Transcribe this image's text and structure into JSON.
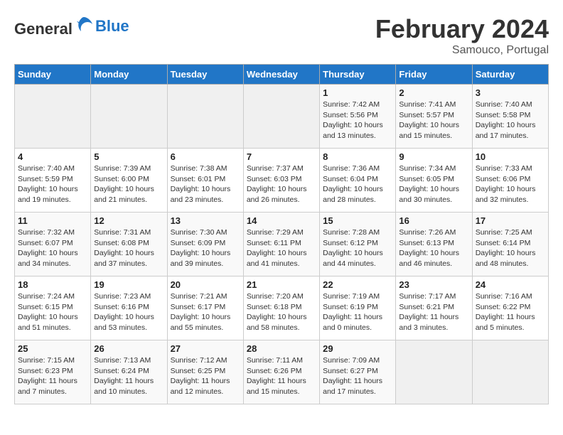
{
  "header": {
    "logo_line1": "General",
    "logo_line2": "Blue",
    "month": "February 2024",
    "location": "Samouco, Portugal"
  },
  "weekdays": [
    "Sunday",
    "Monday",
    "Tuesday",
    "Wednesday",
    "Thursday",
    "Friday",
    "Saturday"
  ],
  "weeks": [
    [
      {
        "day": "",
        "info": ""
      },
      {
        "day": "",
        "info": ""
      },
      {
        "day": "",
        "info": ""
      },
      {
        "day": "",
        "info": ""
      },
      {
        "day": "1",
        "info": "Sunrise: 7:42 AM\nSunset: 5:56 PM\nDaylight: 10 hours and 13 minutes."
      },
      {
        "day": "2",
        "info": "Sunrise: 7:41 AM\nSunset: 5:57 PM\nDaylight: 10 hours and 15 minutes."
      },
      {
        "day": "3",
        "info": "Sunrise: 7:40 AM\nSunset: 5:58 PM\nDaylight: 10 hours and 17 minutes."
      }
    ],
    [
      {
        "day": "4",
        "info": "Sunrise: 7:40 AM\nSunset: 5:59 PM\nDaylight: 10 hours and 19 minutes."
      },
      {
        "day": "5",
        "info": "Sunrise: 7:39 AM\nSunset: 6:00 PM\nDaylight: 10 hours and 21 minutes."
      },
      {
        "day": "6",
        "info": "Sunrise: 7:38 AM\nSunset: 6:01 PM\nDaylight: 10 hours and 23 minutes."
      },
      {
        "day": "7",
        "info": "Sunrise: 7:37 AM\nSunset: 6:03 PM\nDaylight: 10 hours and 26 minutes."
      },
      {
        "day": "8",
        "info": "Sunrise: 7:36 AM\nSunset: 6:04 PM\nDaylight: 10 hours and 28 minutes."
      },
      {
        "day": "9",
        "info": "Sunrise: 7:34 AM\nSunset: 6:05 PM\nDaylight: 10 hours and 30 minutes."
      },
      {
        "day": "10",
        "info": "Sunrise: 7:33 AM\nSunset: 6:06 PM\nDaylight: 10 hours and 32 minutes."
      }
    ],
    [
      {
        "day": "11",
        "info": "Sunrise: 7:32 AM\nSunset: 6:07 PM\nDaylight: 10 hours and 34 minutes."
      },
      {
        "day": "12",
        "info": "Sunrise: 7:31 AM\nSunset: 6:08 PM\nDaylight: 10 hours and 37 minutes."
      },
      {
        "day": "13",
        "info": "Sunrise: 7:30 AM\nSunset: 6:09 PM\nDaylight: 10 hours and 39 minutes."
      },
      {
        "day": "14",
        "info": "Sunrise: 7:29 AM\nSunset: 6:11 PM\nDaylight: 10 hours and 41 minutes."
      },
      {
        "day": "15",
        "info": "Sunrise: 7:28 AM\nSunset: 6:12 PM\nDaylight: 10 hours and 44 minutes."
      },
      {
        "day": "16",
        "info": "Sunrise: 7:26 AM\nSunset: 6:13 PM\nDaylight: 10 hours and 46 minutes."
      },
      {
        "day": "17",
        "info": "Sunrise: 7:25 AM\nSunset: 6:14 PM\nDaylight: 10 hours and 48 minutes."
      }
    ],
    [
      {
        "day": "18",
        "info": "Sunrise: 7:24 AM\nSunset: 6:15 PM\nDaylight: 10 hours and 51 minutes."
      },
      {
        "day": "19",
        "info": "Sunrise: 7:23 AM\nSunset: 6:16 PM\nDaylight: 10 hours and 53 minutes."
      },
      {
        "day": "20",
        "info": "Sunrise: 7:21 AM\nSunset: 6:17 PM\nDaylight: 10 hours and 55 minutes."
      },
      {
        "day": "21",
        "info": "Sunrise: 7:20 AM\nSunset: 6:18 PM\nDaylight: 10 hours and 58 minutes."
      },
      {
        "day": "22",
        "info": "Sunrise: 7:19 AM\nSunset: 6:19 PM\nDaylight: 11 hours and 0 minutes."
      },
      {
        "day": "23",
        "info": "Sunrise: 7:17 AM\nSunset: 6:21 PM\nDaylight: 11 hours and 3 minutes."
      },
      {
        "day": "24",
        "info": "Sunrise: 7:16 AM\nSunset: 6:22 PM\nDaylight: 11 hours and 5 minutes."
      }
    ],
    [
      {
        "day": "25",
        "info": "Sunrise: 7:15 AM\nSunset: 6:23 PM\nDaylight: 11 hours and 7 minutes."
      },
      {
        "day": "26",
        "info": "Sunrise: 7:13 AM\nSunset: 6:24 PM\nDaylight: 11 hours and 10 minutes."
      },
      {
        "day": "27",
        "info": "Sunrise: 7:12 AM\nSunset: 6:25 PM\nDaylight: 11 hours and 12 minutes."
      },
      {
        "day": "28",
        "info": "Sunrise: 7:11 AM\nSunset: 6:26 PM\nDaylight: 11 hours and 15 minutes."
      },
      {
        "day": "29",
        "info": "Sunrise: 7:09 AM\nSunset: 6:27 PM\nDaylight: 11 hours and 17 minutes."
      },
      {
        "day": "",
        "info": ""
      },
      {
        "day": "",
        "info": ""
      }
    ]
  ]
}
